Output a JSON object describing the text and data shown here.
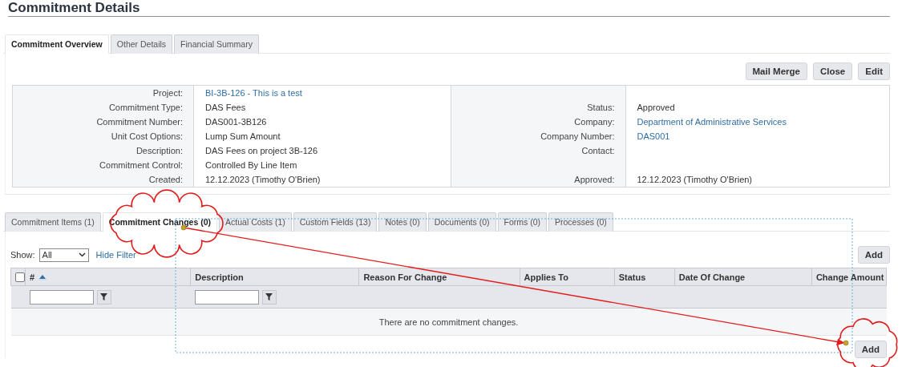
{
  "page": {
    "title": "Commitment Details"
  },
  "top_tabs": [
    {
      "label": "Commitment Overview",
      "selected": true
    },
    {
      "label": "Other Details",
      "selected": false
    },
    {
      "label": "Financial Summary",
      "selected": false
    }
  ],
  "actions": [
    "Mail Merge",
    "Close",
    "Edit"
  ],
  "details_left": [
    {
      "label": "Project:",
      "value": "BI-3B-126 - This is a test",
      "kind": "link"
    },
    {
      "label": "Commitment Type:",
      "value": "DAS Fees",
      "kind": "text"
    },
    {
      "label": "Commitment Number:",
      "value": "DAS001-3B126",
      "kind": "text"
    },
    {
      "label": "Unit Cost Options:",
      "value": "Lump Sum Amount",
      "kind": "text"
    },
    {
      "label": "Description:",
      "value": "DAS Fees on project 3B-126",
      "kind": "text"
    },
    {
      "label": "Commitment Control:",
      "value": "Controlled By Line Item",
      "kind": "text"
    },
    {
      "label": "Created:",
      "value": "12.12.2023 (Timothy O'Brien)",
      "kind": "text"
    }
  ],
  "details_right": [
    {
      "kind": "blank"
    },
    {
      "label": "Status:",
      "value": "Approved",
      "kind": "text"
    },
    {
      "label": "Company:",
      "value": "Department of Administrative Services",
      "kind": "link"
    },
    {
      "label": "Company Number:",
      "value": "DAS001",
      "kind": "link"
    },
    {
      "label": "Contact:",
      "kind": "text"
    },
    {
      "kind": "blank"
    },
    {
      "label": "Approved:",
      "value": "12.12.2023 (Timothy O'Brien)",
      "kind": "text"
    }
  ],
  "lower_tabs": [
    {
      "label": "Commitment Items (1)",
      "selected": false
    },
    {
      "label": "Commitment Changes (0)",
      "selected": true
    },
    {
      "label": "Actual Costs (1)",
      "selected": false
    },
    {
      "label": "Custom Fields (13)",
      "selected": false
    },
    {
      "label": "Notes (0)",
      "selected": false
    },
    {
      "label": "Documents (0)",
      "selected": false
    },
    {
      "label": "Forms (0)",
      "selected": false
    },
    {
      "label": "Processes (0)",
      "selected": false
    }
  ],
  "filter": {
    "show_label": "Show:",
    "show_value": "All",
    "toggle": "Hide Filter"
  },
  "add_button_top": "Add",
  "table": {
    "select_all": {
      "checked": false
    },
    "columns": [
      {
        "label": "#",
        "sorted": true,
        "filterable": true
      },
      {
        "label": "Description",
        "sorted": false,
        "filterable": true
      },
      {
        "label": "Reason For Change",
        "sorted": false,
        "filterable": false
      },
      {
        "label": "Applies To",
        "sorted": false,
        "filterable": false
      },
      {
        "label": "Status",
        "sorted": false,
        "filterable": false
      },
      {
        "label": "Date Of Change",
        "sorted": false,
        "filterable": false
      },
      {
        "label": "Change Amount",
        "sorted": false,
        "filterable": false
      }
    ],
    "empty_message": "There are no commitment changes."
  },
  "add_button_bottom": "Add"
}
